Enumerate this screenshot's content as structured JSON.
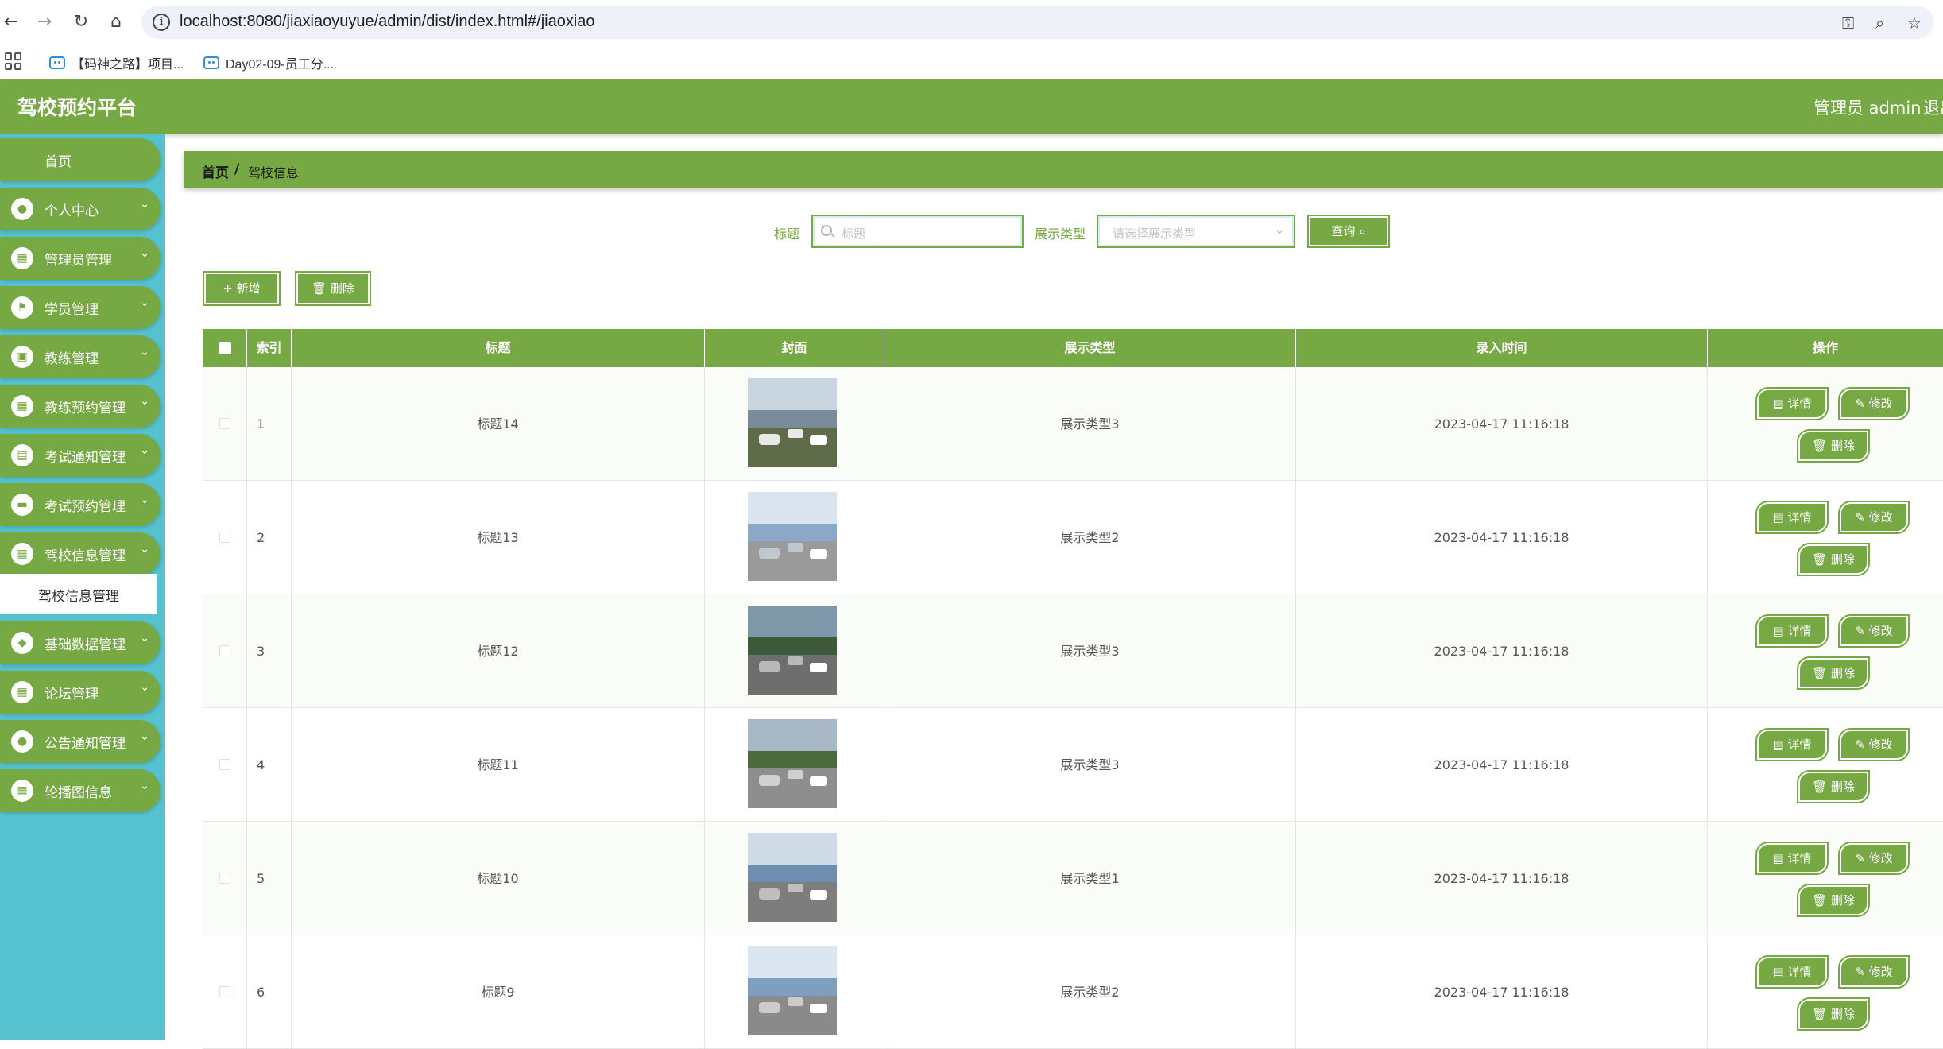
{
  "browser": {
    "url": "localhost:8080/jiaxiaoyuyue/admin/dist/index.html#/jiaoxiao",
    "bookmarks": [
      "【码神之路】项目...",
      "Day02-09-员工分..."
    ]
  },
  "header": {
    "title": "驾校预约平台",
    "user": "管理员 admin",
    "logout": "退出"
  },
  "sidebar": {
    "home": "首页",
    "items": [
      {
        "label": "个人中心",
        "icon": "user-icon"
      },
      {
        "label": "管理员管理",
        "icon": "grid-icon"
      },
      {
        "label": "学员管理",
        "icon": "flag-icon"
      },
      {
        "label": "教练管理",
        "icon": "briefcase-icon"
      },
      {
        "label": "教练预约管理",
        "icon": "grid-icon"
      },
      {
        "label": "考试通知管理",
        "icon": "clipboard-icon"
      },
      {
        "label": "考试预约管理",
        "icon": "chat-icon"
      },
      {
        "label": "驾校信息管理",
        "icon": "grid-icon"
      },
      {
        "label": "基础数据管理",
        "icon": "cup-icon"
      },
      {
        "label": "论坛管理",
        "icon": "grid-icon"
      },
      {
        "label": "公告通知管理",
        "icon": "user-icon"
      },
      {
        "label": "轮播图信息",
        "icon": "grid-icon"
      }
    ],
    "submenu_active": "驾校信息管理"
  },
  "breadcrumb": {
    "home": "首页",
    "separator": "/",
    "current": "驾校信息"
  },
  "filters": {
    "title_label": "标题",
    "title_placeholder": "标题",
    "type_label": "展示类型",
    "type_placeholder": "请选择展示类型",
    "search_button": "查询"
  },
  "actions": {
    "add": "新增",
    "delete": "删除"
  },
  "table": {
    "columns": [
      "索引",
      "标题",
      "封面",
      "展示类型",
      "录入时间",
      "操作"
    ],
    "rows": [
      {
        "index": "1",
        "title": "标题14",
        "type": "展示类型3",
        "time": "2023-04-17 11:16:18"
      },
      {
        "index": "2",
        "title": "标题13",
        "type": "展示类型2",
        "time": "2023-04-17 11:16:18"
      },
      {
        "index": "3",
        "title": "标题12",
        "type": "展示类型3",
        "time": "2023-04-17 11:16:18"
      },
      {
        "index": "4",
        "title": "标题11",
        "type": "展示类型3",
        "time": "2023-04-17 11:16:18"
      },
      {
        "index": "5",
        "title": "标题10",
        "type": "展示类型1",
        "time": "2023-04-17 11:16:18"
      },
      {
        "index": "6",
        "title": "标题9",
        "type": "展示类型2",
        "time": "2023-04-17 11:16:18"
      }
    ],
    "row_actions": {
      "detail": "详情",
      "edit": "修改",
      "delete": "删除"
    }
  },
  "colors": {
    "primary": "#76a843",
    "sidebar_bg": "#56c2cf"
  }
}
